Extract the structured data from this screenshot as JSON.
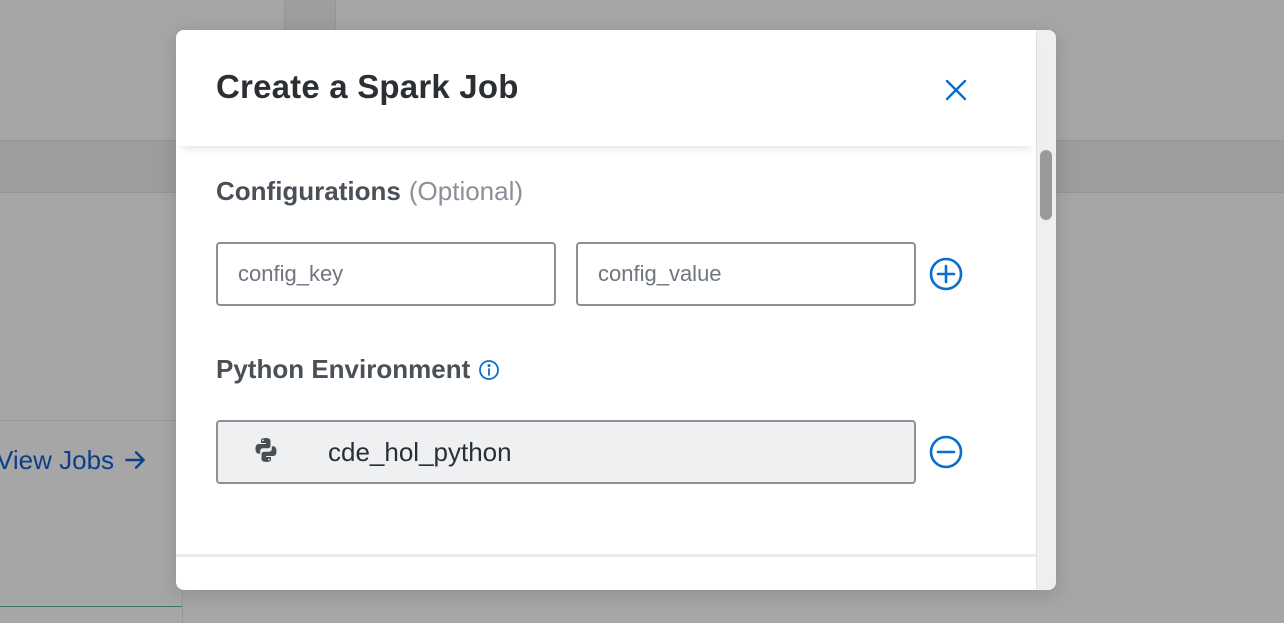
{
  "background": {
    "view_jobs_label": "View Jobs",
    "view_jobs_icon": "arrow-right-icon"
  },
  "modal": {
    "title": "Create a Spark Job",
    "close_icon": "close-icon",
    "configurations": {
      "label": "Configurations",
      "optional_label": "(Optional)",
      "key_placeholder": "config_key",
      "value_placeholder": "config_value",
      "add_icon": "plus-circle-icon"
    },
    "python_environment": {
      "label": "Python Environment",
      "info_icon": "info-icon",
      "value": "cde_hol_python",
      "python_icon": "python-icon",
      "remove_icon": "minus-circle-icon"
    }
  },
  "colors": {
    "accent": "#0a6ed1",
    "link": "#0a3f8a",
    "text": "#2b2f33",
    "overlay": "#a6a6a6"
  }
}
